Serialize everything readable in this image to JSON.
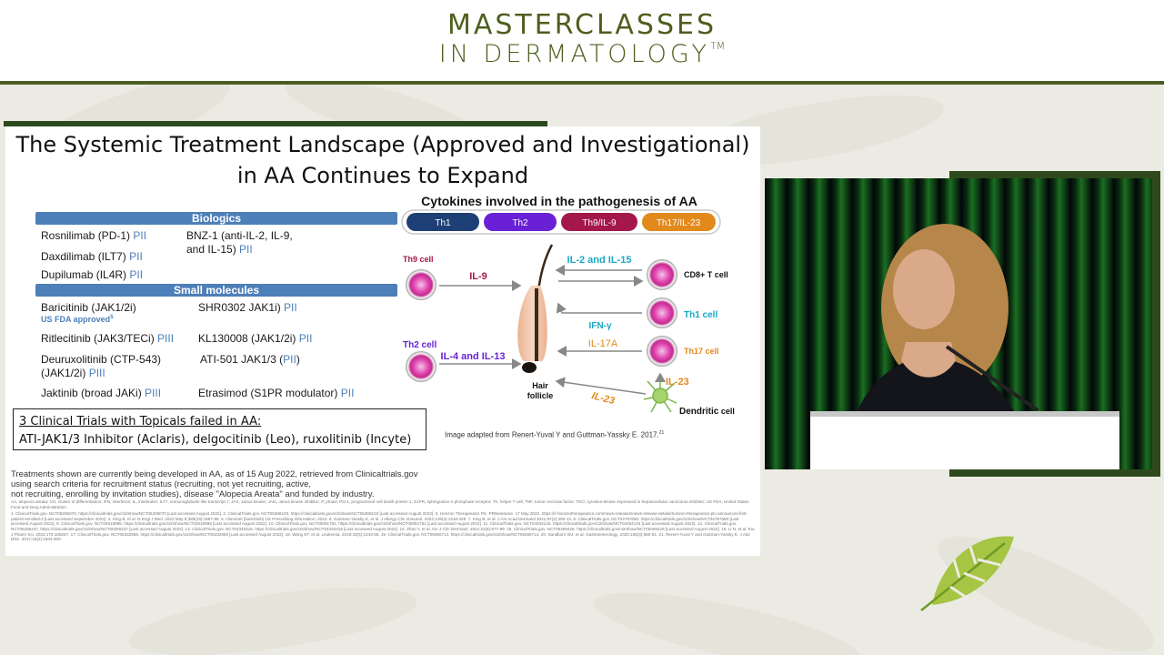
{
  "header": {
    "line1": "MASTERCLASSES",
    "line2": "IN DERMATOLOGY",
    "trademark": "TM"
  },
  "slide": {
    "title_line1": "The Systemic Treatment Landscape (Approved and Investigational)",
    "title_line2": "in AA Continues to Expand",
    "biologics_header": "Biologics",
    "small_molecules_header": "Small molecules",
    "biologics": [
      {
        "name": "Rosnilimab (PD-1) ",
        "phase": "PII"
      },
      {
        "name": "Daxdilimab (ILT7) ",
        "phase": "PII"
      },
      {
        "name": "Dupilumab (IL4R) ",
        "phase": "PII"
      },
      {
        "name": "BNZ-1 (anti-IL-2, IL-9,",
        "name2": "and IL-15) ",
        "phase": "PII"
      }
    ],
    "small_molecules": [
      {
        "name": "Baricitinib (JAK1/2i)",
        "phase": ""
      },
      {
        "name": "SHR0302 JAK1i) ",
        "phase": "PII"
      },
      {
        "name": "Ritlecitinib (JAK3/TECi) ",
        "phase": "PIII"
      },
      {
        "name": "KL130008 (JAK1/2i) ",
        "phase": "PII"
      },
      {
        "name": "Deuruxolitinib (CTP-543)",
        "name2": "(JAK1/2i) ",
        "phase": "PIII"
      },
      {
        "name": "ATI-501 JAK1/3 (",
        "phase": "PII",
        "suffix": ")"
      },
      {
        "name": "Jaktinib (broad JAKi) ",
        "phase": "PIII"
      },
      {
        "name": "Etrasimod (S1PR modulator) ",
        "phase": "PII"
      }
    ],
    "fda_label": "US FDA approved",
    "fda_sup": "5",
    "topicals_line1": "3 Clinical Trials with Topicals failed in AA:",
    "topicals_line2": "ATI-JAK1/3 Inhibitor (Aclaris), delgocitinib (Leo), ruxolitinib (Incyte)",
    "disclaimer_line1": "Treatments shown are currently being developed in AA, as of 15 Aug 2022, retrieved from Clinicaltrials.gov",
    "disclaimer_line2": "using search criteria for recruitment status (recruiting, not yet recruiting, active,",
    "disclaimer_line3": "not recruiting, enrolling by invitation studies), disease \"Alopecia Areata\" and funded by industry.",
    "abbreviations": "AA, alopecia areata; CD, cluster of differentiation; IFN, interferon; IL, interleukin; ILT7, immunoglobulin-like transcript 7; JAK, Janus kinase; JAKi, Janus kinase inhibitor; P, phase; PD-1, programmed cell death protein 1; S1PR, sphingosine-1-phosphate receptor; Th, helper T cell; TNF, tumor necrosis factor; TECi, tyrosine-kinase expressed in hepatocellular carcinoma inhibitor; US FDA, United States Food and Drug Administration.",
    "references": "1. ClinicalTrials.gov. NCT05205070. https://clinicaltrials.gov/ct2/show/NCT05205070 [Last accessed August 2022]. 2. ClinicalTrials.gov. NCT05368103. https://clinicaltrials.gov/ct2/show/NCT05368103 [Last accessed August 2022]. 3. Horizon Therapeutics Plc. PRNewswire. 17 May 2022. https://ir.horizontherapeutics.com/news-releases/news-release-details/horizon-therapeutics-plc-announces-first-patient-enrolled-2 [Last accessed September 2022]. 4. King B, et al. N Engl J Med. 2022 May 5;386(18):1687-99. 5. Olumiant (baricitinib) US Prescribing Information, 2022. 6. Guttman-Yassky E, et al. J Allergy Clin Immunol. 2022;149(4):1318-328. 7. King B, et al. J Am Acad Dermatol 2021;87(2):306-13. 8. ClinicalTrials.gov. NCT04797650. https://clinicaltrials.gov/ct2/show/NCT04797650 [Last accessed August 2022]. 9. ClinicalTrials.gov. NCT04518995. https://clinicaltrials.gov/ct2/show/NCT04518995 [Last accessed August 2022]. 10. ClinicalTrials.gov. NCT05051761. https://clinicaltrials.gov/ct2/show/NCT05051761 [Last accessed August 2022]. 11. ClinicalTrials.gov. NCT04034134. https://clinicaltrials.gov/ct2/show/NCT04034134 [Last accessed August 2022]. 12. ClinicalTrials.gov. NCT05255237. https://clinicaltrials.gov/ct2/show/NCT05255237 [Last accessed August 2022]. 13. ClinicalTrials.gov. NCT04346316. https://clinicaltrials.gov/ct2/show/NCT04346316 [Last accessed August 2022]. 14. Zhao Y, et al. Am J Clin Dermatol. 2021;22(6):877-89. 15. ClinicalTrials.gov. NCT05469426. https://clinicaltrials.gov/ct2/show/NCT05469426 [Last accessed August 2022]. 16. Li N, et al. Eur J Pharm Sci. 2022;176:106257. 17. ClinicalTrials.gov. NCT05332958. https://clinicaltrials.gov/ct2/show/NCT05332958 [Last accessed August 2022]. 18. Wang ET, et al. Leukemia. 2019;33(5):1243-55. 19. ClinicalTrials.gov. NCT05056714. https://clinicaltrials.gov/ct2/show/NCT05056714. 20. Sandborn WJ, et al. Gastroenterology. 2020;158(3):550-61. 21. Renert-Yuval Y and Guttman-Yassky E. J Adv Dtsc. 2017;16(2):1504-609.",
    "credit": "Image adapted from Renert-Yuval Y and Guttman-Yassky E. 2017.",
    "credit_sup": "21"
  },
  "diagram": {
    "title": "Cytokines involved in the pathogenesis of AA",
    "pills": [
      {
        "label": "Th1",
        "color": "#1e3f75"
      },
      {
        "label": "Th2",
        "color": "#6a21d6"
      },
      {
        "label": "Th9/IL-9",
        "color": "#a3174a"
      },
      {
        "label": "Th17/IL-23",
        "color": "#e2891c"
      }
    ],
    "th9_cell": "Th9 cell",
    "th2_cell": "Th2 cell",
    "il9": "IL-9",
    "il4_il13": "IL-4 and IL-13",
    "il2_il15": "IL-2 and IL-15",
    "ifn_gamma": "IFN-γ",
    "il17a": "IL-17A",
    "il23_left": "IL-23",
    "il23_right": "IL-23",
    "hair_follicle_1": "Hair",
    "hair_follicle_2": "follicle",
    "cd8_cell": "CD8+ T cell",
    "th1_cell": "Th1 cell",
    "th17_cell": "Th17 cell",
    "dendritic_1": "Dendritic",
    "dendritic_2": " cell"
  },
  "colors": {
    "brand": "#4e5f1e",
    "bar": "#4d7fb8",
    "th1": "#1e3f75",
    "th2": "#6a21d6",
    "th9": "#a3174a",
    "th17": "#e2891c",
    "cyan": "#1aa8c7"
  }
}
